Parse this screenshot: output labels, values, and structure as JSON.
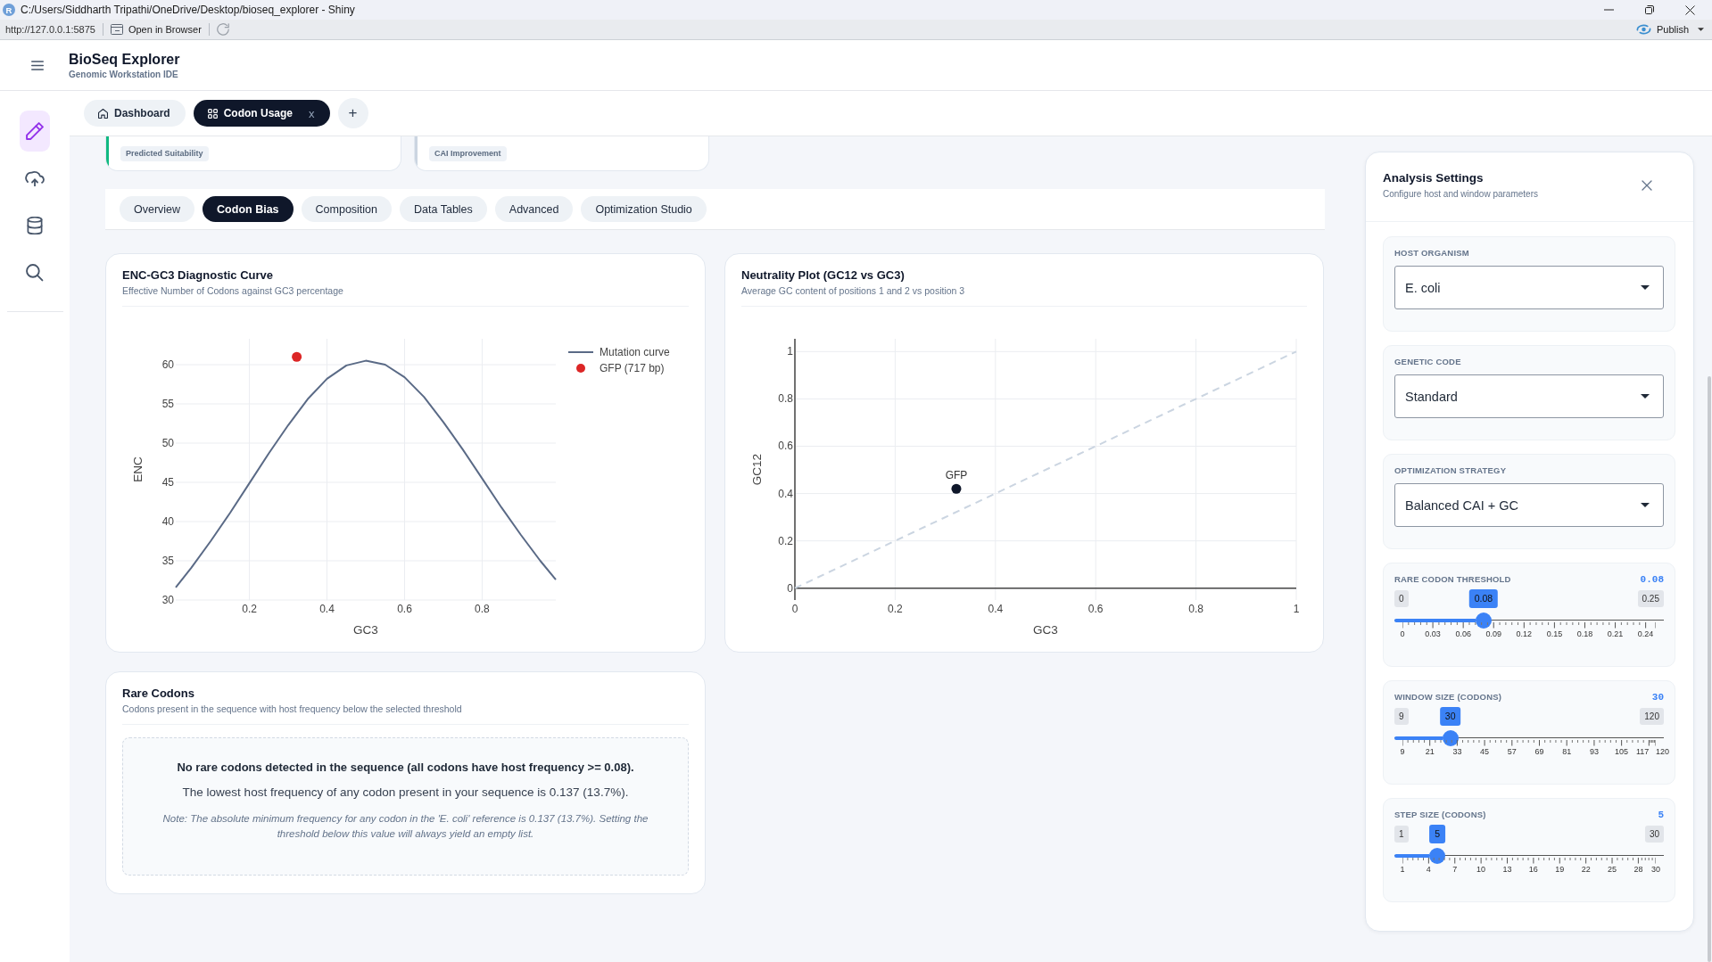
{
  "window": {
    "title": "C:/Users/Siddharth Tripathi/OneDrive/Desktop/bioseq_explorer - Shiny",
    "app_badge": "R"
  },
  "browser_toolbar": {
    "url": "http://127.0.0.1:5875",
    "open_in_browser": "Open in Browser",
    "publish": "Publish"
  },
  "header": {
    "title": "BioSeq Explorer",
    "subtitle": "Genomic Workstation IDE"
  },
  "sidebar": {
    "items": [
      {
        "kind": "edit",
        "selected": true
      },
      {
        "kind": "upload",
        "selected": false
      },
      {
        "kind": "database",
        "selected": false
      },
      {
        "kind": "search",
        "selected": false
      }
    ]
  },
  "workspace_tabs": {
    "tabs": [
      {
        "label": "Dashboard",
        "kind": "home",
        "selected": false
      },
      {
        "label": "Codon Usage",
        "kind": "grid",
        "selected": true,
        "close": "x"
      }
    ],
    "add": "+"
  },
  "summary_cards": [
    {
      "badge": "Predicted Suitability",
      "color": "#10b981"
    },
    {
      "badge": "CAI Improvement",
      "color": "#cbd5e1"
    }
  ],
  "analysis_tabs": [
    {
      "label": "Overview",
      "selected": false
    },
    {
      "label": "Codon Bias",
      "selected": true
    },
    {
      "label": "Composition",
      "selected": false
    },
    {
      "label": "Data Tables",
      "selected": false
    },
    {
      "label": "Advanced",
      "selected": false
    },
    {
      "label": "Optimization Studio",
      "selected": false
    }
  ],
  "charts": [
    {
      "title": "ENC-GC3 Diagnostic Curve",
      "subtitle": "Effective Number of Codons against GC3 percentage",
      "chart_data": {
        "type": "line",
        "xlabel": "GC3",
        "ylabel": "ENC",
        "x": [
          0.01,
          0.05,
          0.1,
          0.15,
          0.2,
          0.25,
          0.3,
          0.35,
          0.4,
          0.45,
          0.5,
          0.55,
          0.6,
          0.65,
          0.7,
          0.75,
          0.8,
          0.85,
          0.9,
          0.95,
          0.99
        ],
        "series": [
          {
            "name": "Mutation curve",
            "color": "#5a6a86",
            "values": [
              31.6,
              34.1,
              37.5,
              41.1,
              44.9,
              48.7,
              52.3,
              55.6,
              58.2,
              59.9,
              60.5,
              60.0,
              58.4,
              55.9,
              52.7,
              49.2,
              45.5,
              41.8,
              38.3,
              35.0,
              32.6
            ]
          },
          {
            "name": "GFP (717 bp)",
            "color": "#dc2626",
            "marker": "circle",
            "x": [
              0.322
            ],
            "values": [
              61
            ]
          }
        ],
        "xlim": [
          0.01,
          0.99
        ],
        "ylim": [
          30,
          63.3
        ],
        "xticks": [
          {
            "value": 0.2,
            "label": "0.2"
          },
          {
            "value": 0.4,
            "label": "0.4"
          },
          {
            "value": 0.6,
            "label": "0.6"
          },
          {
            "value": 0.8,
            "label": "0.8"
          }
        ],
        "yticks": [
          {
            "value": 30,
            "label": "30"
          },
          {
            "value": 35,
            "label": "35"
          },
          {
            "value": 40,
            "label": "40"
          },
          {
            "value": 45,
            "label": "45"
          },
          {
            "value": 50,
            "label": "50"
          },
          {
            "value": 55,
            "label": "55"
          },
          {
            "value": 60,
            "label": "60"
          }
        ],
        "grid": true,
        "legend": true
      }
    },
    {
      "title": "Neutrality Plot (GC12 vs GC3)",
      "subtitle": "Average GC content of positions 1 and 2 vs position 3",
      "chart_data": {
        "type": "line",
        "xlabel": "GC3",
        "ylabel": "GC12",
        "series": [
          {
            "color": "#cbd5e1",
            "line_style": "dashed",
            "x": [
              0,
              1
            ],
            "values": [
              0,
              1
            ]
          },
          {
            "color": "#0f172a",
            "marker": "circle",
            "x": [
              0.322
            ],
            "values": [
              0.42
            ]
          }
        ],
        "xlim": [
          0,
          1
        ],
        "ylim": [
          -0.05,
          1.054
        ],
        "xticks": [
          {
            "value": 0,
            "label": "0"
          },
          {
            "value": 0.2,
            "label": "0.2"
          },
          {
            "value": 0.4,
            "label": "0.4"
          },
          {
            "value": 0.6,
            "label": "0.6"
          },
          {
            "value": 0.8,
            "label": "0.8"
          },
          {
            "value": 1,
            "label": "1"
          }
        ],
        "yticks": [
          {
            "value": 0,
            "label": "0"
          },
          {
            "value": 0.2,
            "label": "0.2"
          },
          {
            "value": 0.4,
            "label": "0.4"
          },
          {
            "value": 0.6,
            "label": "0.6"
          },
          {
            "value": 0.8,
            "label": "0.8"
          },
          {
            "value": 1,
            "label": "1"
          }
        ],
        "grid": true,
        "annotations": [
          {
            "text": "GFP",
            "x": 0.322,
            "y": 0.42
          }
        ]
      }
    }
  ],
  "rare_codons": {
    "title": "Rare Codons",
    "subtitle": "Codons present in the sequence with host frequency below the selected threshold",
    "message": "No rare codons detected in the sequence (all codons have host frequency >= 0.08).",
    "detail": "The lowest host frequency of any codon present in your sequence is 0.137 (13.7%).",
    "note": "Note: The absolute minimum frequency for any codon in the 'E. coli' reference is 0.137 (13.7%). Setting the threshold below this value will always yield an empty list."
  },
  "settings": {
    "title": "Analysis Settings",
    "subtitle": "Configure host and window parameters",
    "fields": [
      {
        "kind": "select",
        "label": "HOST ORGANISM",
        "value": "E. coli"
      },
      {
        "kind": "select",
        "label": "GENETIC CODE",
        "value": "Standard"
      },
      {
        "kind": "select",
        "label": "OPTIMIZATION STRATEGY",
        "value": "Balanced CAI + GC"
      },
      {
        "kind": "slider",
        "label": "RARE CODON THRESHOLD",
        "reading": "0.08",
        "min": "0",
        "max": "0.25",
        "value": "0.08",
        "level": 0.32,
        "ticks": [
          "0",
          "0.03",
          "0.06",
          "0.09",
          "0.12",
          "0.15",
          "0.18",
          "0.21",
          "0.24"
        ]
      },
      {
        "kind": "slider",
        "label": "WINDOW SIZE (CODONS)",
        "reading": "30",
        "min": "9",
        "max": "120",
        "value": "30",
        "level": 0.189,
        "ticks": [
          "9",
          "21",
          "33",
          "45",
          "57",
          "69",
          "81",
          "93",
          "105",
          "117",
          "120"
        ]
      },
      {
        "kind": "slider",
        "label": "STEP SIZE (CODONS)",
        "reading": "5",
        "min": "1",
        "max": "30",
        "value": "5",
        "level": 0.138,
        "ticks": [
          "1",
          "4",
          "7",
          "10",
          "13",
          "16",
          "19",
          "22",
          "25",
          "28",
          "30"
        ]
      }
    ]
  }
}
